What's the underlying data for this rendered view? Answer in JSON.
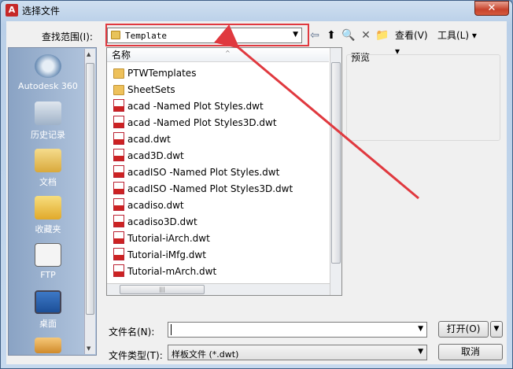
{
  "window": {
    "title": "选择文件",
    "app_icon": "autocad-logo-icon",
    "close_icon": "close-icon",
    "close_glyph": "✕"
  },
  "toolbar": {
    "lookin_label": "查找范围(I):",
    "lookin_value": "Template",
    "view_label": "查看(V)",
    "tools_label": "工具(L)",
    "back_glyph": "⇦",
    "up_glyph": "⬆",
    "search_glyph": "🔍",
    "delete_glyph": "✕",
    "newfolder_glyph": "📁"
  },
  "sidebar": {
    "items": [
      {
        "label": "Autodesk 360",
        "icon": "cloud-icon"
      },
      {
        "label": "历史记录",
        "icon": "history-icon"
      },
      {
        "label": "文档",
        "icon": "documents-icon"
      },
      {
        "label": "收藏夹",
        "icon": "favorites-icon"
      },
      {
        "label": "FTP",
        "icon": "ftp-icon"
      },
      {
        "label": "桌面",
        "icon": "desktop-icon"
      }
    ]
  },
  "filelist": {
    "column_header": "名称",
    "items": [
      {
        "name": "PTWTemplates",
        "type": "folder"
      },
      {
        "name": "SheetSets",
        "type": "folder"
      },
      {
        "name": "acad -Named Plot Styles.dwt",
        "type": "dwt"
      },
      {
        "name": "acad -Named Plot Styles3D.dwt",
        "type": "dwt"
      },
      {
        "name": "acad.dwt",
        "type": "dwt"
      },
      {
        "name": "acad3D.dwt",
        "type": "dwt"
      },
      {
        "name": "acadISO -Named Plot Styles.dwt",
        "type": "dwt"
      },
      {
        "name": "acadISO -Named Plot Styles3D.dwt",
        "type": "dwt"
      },
      {
        "name": "acadiso.dwt",
        "type": "dwt"
      },
      {
        "name": "acadiso3D.dwt",
        "type": "dwt"
      },
      {
        "name": "Tutorial-iArch.dwt",
        "type": "dwt"
      },
      {
        "name": "Tutorial-iMfg.dwt",
        "type": "dwt"
      },
      {
        "name": "Tutorial-mArch.dwt",
        "type": "dwt"
      }
    ]
  },
  "preview": {
    "label": "预览"
  },
  "bottom": {
    "filename_label": "文件名(N):",
    "filename_value": "",
    "filetype_label": "文件类型(T):",
    "filetype_value": "样板文件 (*.dwt)",
    "open_label": "打开(O)",
    "cancel_label": "取消"
  },
  "colors": {
    "highlight": "#e0393f",
    "arrow": "#e0393f"
  }
}
